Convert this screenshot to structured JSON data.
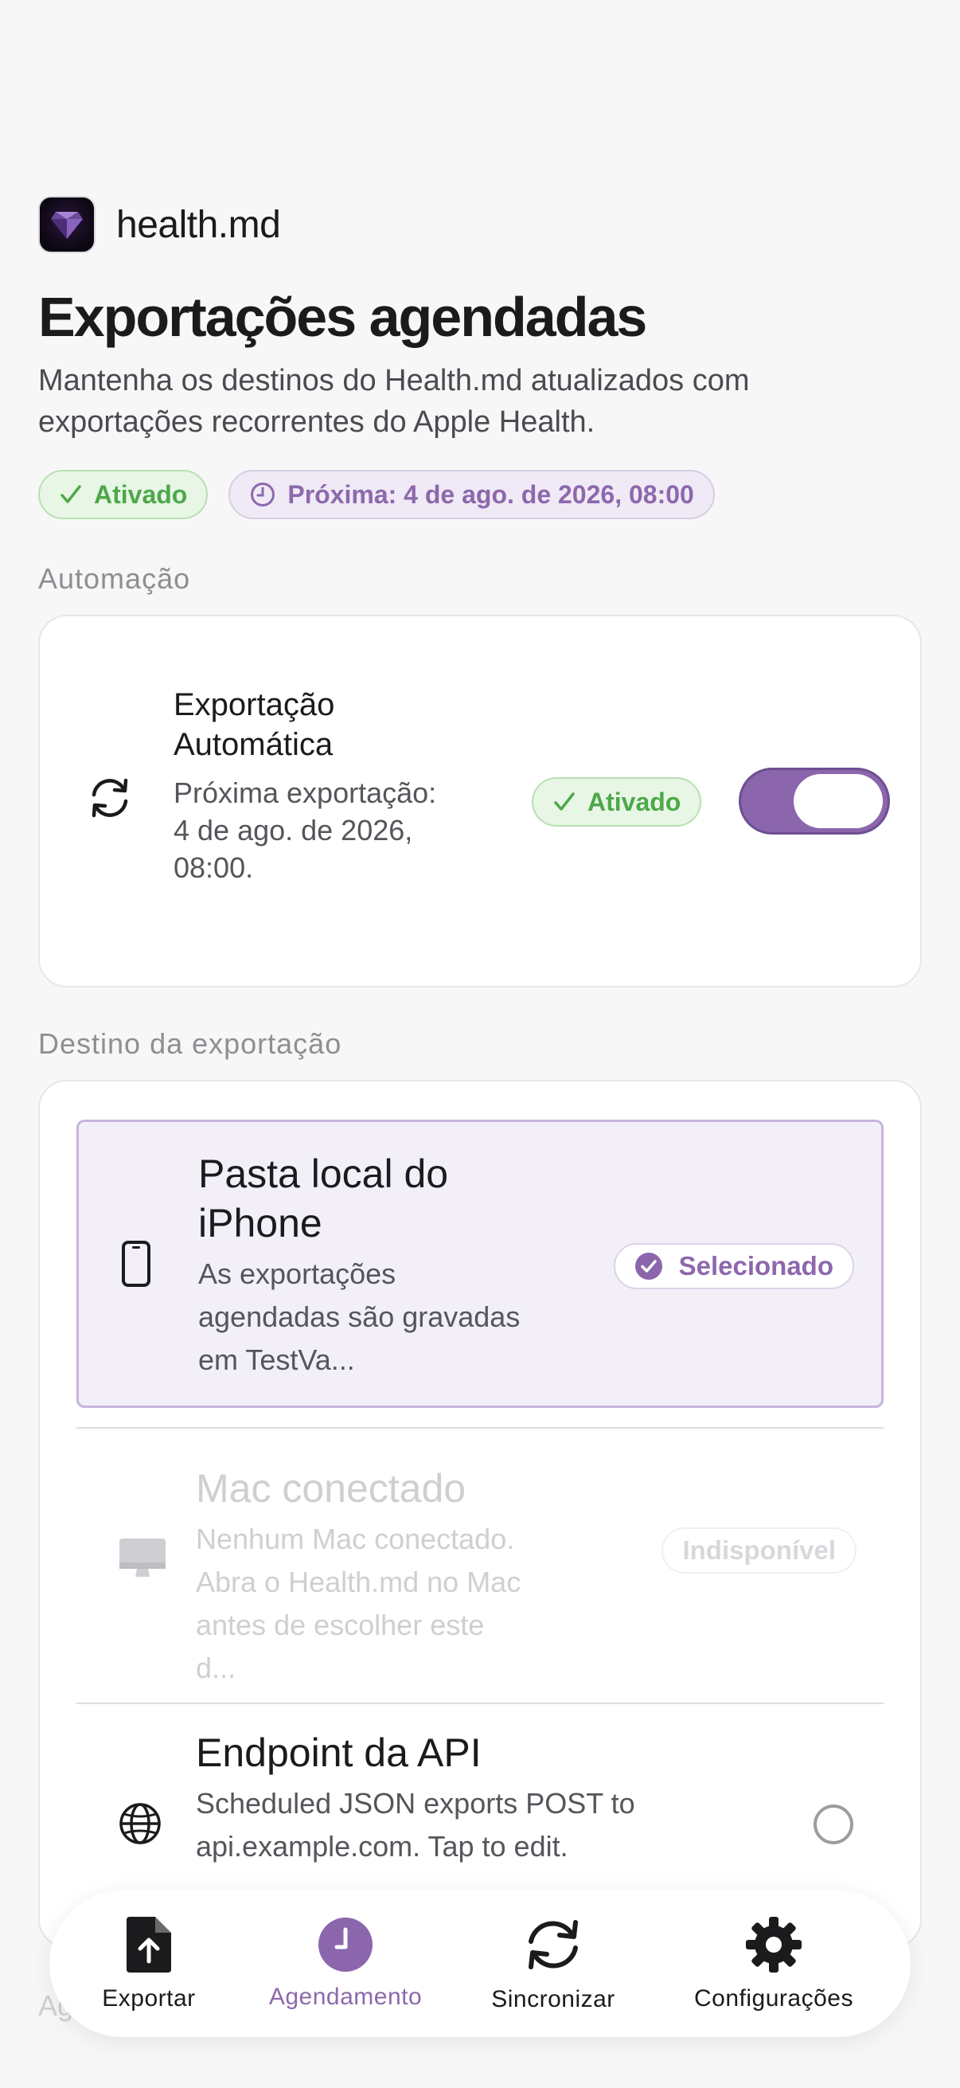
{
  "app": {
    "name": "health.md"
  },
  "page": {
    "title": "Exportações agendadas",
    "subtitle": "Mantenha os destinos do Health.md atualizados com exportações recorrentes do Apple Health."
  },
  "status": {
    "enabled_label": "Ativado",
    "next_label": "Próxima: 4 de ago. de 2026, 08:00"
  },
  "automation": {
    "section_label": "Automação",
    "title": "Exportação Automática",
    "description": "Próxima exportação: 4 de ago. de 2026, 08:00.",
    "badge": "Ativado",
    "toggle_on": true
  },
  "destination": {
    "section_label": "Destino da exportação",
    "items": [
      {
        "title": "Pasta local do iPhone",
        "description": "As exportações agendadas são gravadas em TestVa...",
        "badge": "Selecionado"
      },
      {
        "title": "Mac conectado",
        "description": "Nenhum Mac conectado. Abra o Health.md no Mac antes de escolher este d...",
        "badge": "Indisponível"
      },
      {
        "title": "Endpoint da API",
        "description": "Scheduled JSON exports POST to api.example.com. Tap to edit."
      }
    ]
  },
  "next_section_partial": "Ag",
  "tabs": [
    {
      "label": "Exportar",
      "icon": "export-doc-icon"
    },
    {
      "label": "Agendamento",
      "icon": "clock-icon",
      "active": true
    },
    {
      "label": "Sincronizar",
      "icon": "sync-icon"
    },
    {
      "label": "Configurações",
      "icon": "gear-icon"
    }
  ],
  "colors": {
    "accent": "#8b66ad",
    "success": "#4ea84a",
    "background": "#f7f7f8"
  }
}
